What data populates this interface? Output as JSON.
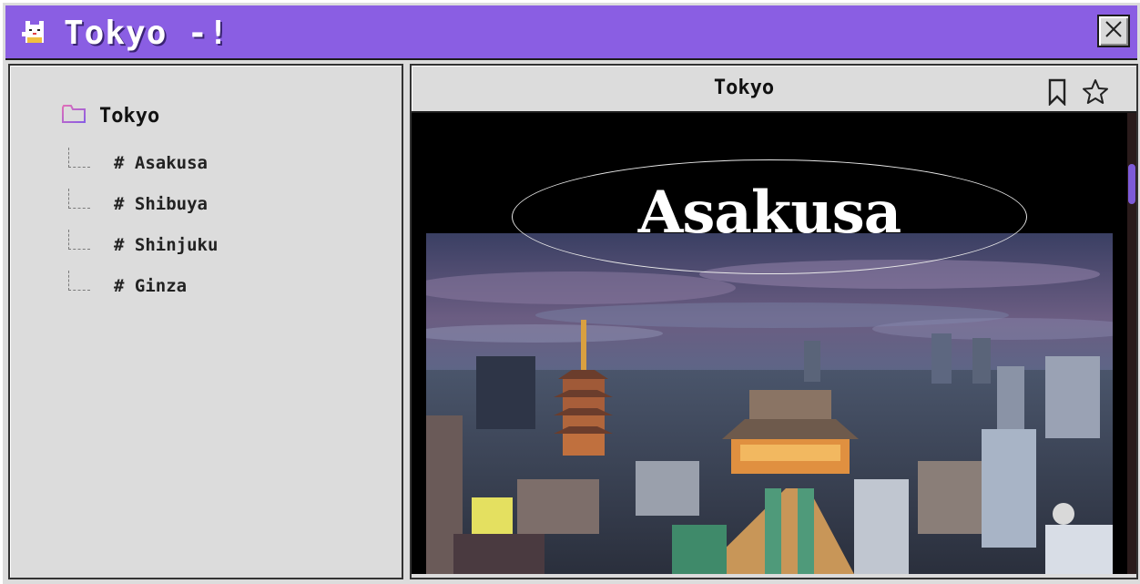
{
  "window": {
    "title": "Tokyo -!",
    "title_icon": "lucky-cat-icon",
    "close_icon": "close-icon",
    "accent": "#8a5ee3"
  },
  "sidebar": {
    "root": {
      "label": "Tokyo",
      "icon": "folder-icon"
    },
    "items": [
      {
        "label": "# Asakusa"
      },
      {
        "label": "# Shibuya"
      },
      {
        "label": "# Shinjuku"
      },
      {
        "label": "# Ginza"
      }
    ]
  },
  "content": {
    "title": "Tokyo",
    "bookmark_icon": "bookmark-icon",
    "favorite_icon": "star-icon",
    "heading": "Asakusa",
    "image": "asakusa-city-night-photo"
  }
}
